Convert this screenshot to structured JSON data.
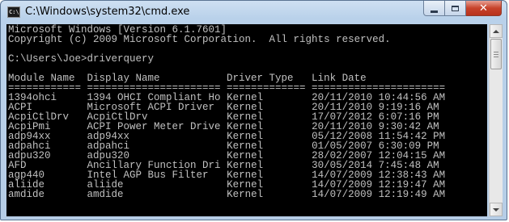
{
  "window": {
    "title": "C:\\Windows\\system32\\cmd.exe",
    "icon": "cmd-icon",
    "icon_text": "C:\\"
  },
  "controls": {
    "minimize": "minimize-icon",
    "maximize": "maximize-icon",
    "close": "close-icon",
    "close_glyph": "✕"
  },
  "console": {
    "lines": [
      "Microsoft Windows [Version 6.1.7601]",
      "Copyright (c) 2009 Microsoft Corporation.  All rights reserved.",
      "",
      "C:\\Users\\Joe>driverquery",
      "",
      "Module Name  Display Name           Driver Type   Link Date",
      "============ ====================== ============= ======================"
    ],
    "rows": [
      [
        "1394ohci",
        "1394 OHCI Compliant Ho",
        "Kernel",
        "20/11/2010 10:44:56 AM"
      ],
      [
        "ACPI",
        "Microsoft ACPI Driver",
        "Kernel",
        "20/11/2010 9:19:16 AM"
      ],
      [
        "AcpiCtlDrv",
        "AcpiCtlDrv",
        "Kernel",
        "17/07/2012 6:07:16 PM"
      ],
      [
        "AcpiPmi",
        "ACPI Power Meter Drive",
        "Kernel",
        "20/11/2010 9:30:42 AM"
      ],
      [
        "adp94xx",
        "adp94xx",
        "Kernel",
        "05/12/2008 11:54:42 PM"
      ],
      [
        "adpahci",
        "adpahci",
        "Kernel",
        "01/05/2007 6:30:09 PM"
      ],
      [
        "adpu320",
        "adpu320",
        "Kernel",
        "28/02/2007 12:04:15 AM"
      ],
      [
        "AFD",
        "Ancillary Function Dri",
        "Kernel",
        "30/05/2014 7:45:48 AM"
      ],
      [
        "agp440",
        "Intel AGP Bus Filter",
        "Kernel",
        "14/07/2009 12:38:43 AM"
      ],
      [
        "aliide",
        "aliide",
        "Kernel",
        "14/07/2009 12:19:47 AM"
      ],
      [
        "amdide",
        "amdide",
        "Kernel",
        "14/07/2009 12:19:49 AM"
      ]
    ],
    "colors": {
      "background": "#000000",
      "foreground": "#c0c0c0"
    }
  },
  "scrollbar": {
    "up": "scroll-up-arrow-icon",
    "down": "scroll-down-arrow-icon"
  }
}
